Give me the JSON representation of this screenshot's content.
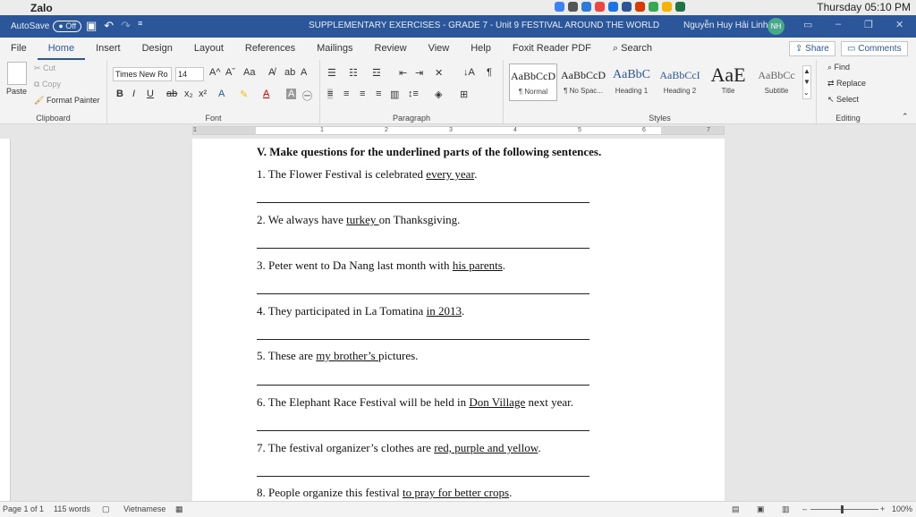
{
  "macbar": {
    "app_name": "Zalo",
    "clock": "Thursday 05:10 PM"
  },
  "titlebar": {
    "autosave_label": "AutoSave",
    "autosave_state": "Off",
    "doc_title": "SUPPLEMENTARY EXERCISES - GRADE 7 - Unit 9 FESTIVAL AROUND THE WORLD",
    "user_name": "Nguyễn Huy Hải Linh",
    "user_initials": "NH"
  },
  "tabs": [
    "File",
    "Home",
    "Insert",
    "Design",
    "Layout",
    "References",
    "Mailings",
    "Review",
    "View",
    "Help",
    "Foxit Reader PDF"
  ],
  "search_label": "Search",
  "share_label": "Share",
  "comments_label": "Comments",
  "clipboard": {
    "paste": "Paste",
    "cut": "Cut",
    "copy": "Copy",
    "format_painter": "Format Painter",
    "label": "Clipboard"
  },
  "font": {
    "name": "Times New Ro",
    "size": "14",
    "label": "Font"
  },
  "paragraph": {
    "label": "Paragraph"
  },
  "styles": {
    "label": "Styles",
    "items": [
      {
        "preview": "AaBbCcD",
        "name": "¶ Normal"
      },
      {
        "preview": "AaBbCcD",
        "name": "¶ No Spac..."
      },
      {
        "preview": "AaBbC",
        "name": "Heading 1"
      },
      {
        "preview": "AaBbCcI",
        "name": "Heading 2"
      },
      {
        "preview": "AaE",
        "name": "Title"
      },
      {
        "preview": "AaBbCc",
        "name": "Subtitle"
      }
    ]
  },
  "editing": {
    "find": "Find",
    "replace": "Replace",
    "select": "Select",
    "label": "Editing"
  },
  "ruler_numbers": [
    "1",
    "1",
    "2",
    "3",
    "4",
    "5",
    "6",
    "7"
  ],
  "document": {
    "heading": "V. Make questions for the underlined parts of the following sentences.",
    "questions": [
      {
        "pre": "1.  The Flower Festival is celebrated ",
        "u": "every year",
        "post": "."
      },
      {
        "pre": "2. We always have ",
        "u": "turkey ",
        "post": "on Thanksgiving."
      },
      {
        "pre": "3. Peter went to Da Nang last month with ",
        "u": "his parents",
        "post": "."
      },
      {
        "pre": "4. They participated in La Tomatina ",
        "u": "in 2013",
        "post": "."
      },
      {
        "pre": "5. These are ",
        "u": "my brother’s ",
        "post": "pictures."
      },
      {
        "pre": "6. The Elephant Race Festival will be held in ",
        "u": "Don Village",
        "post": " next year."
      },
      {
        "pre": "7. The festival organizer’s clothes are ",
        "u": "red, purple and yellow",
        "post": "."
      },
      {
        "pre": "8. People organize this festival ",
        "u": "to pray for better crops",
        "post": "."
      }
    ]
  },
  "status": {
    "page": "Page 1 of 1",
    "words": "115 words",
    "language": "Vietnamese",
    "zoom": "100%"
  }
}
